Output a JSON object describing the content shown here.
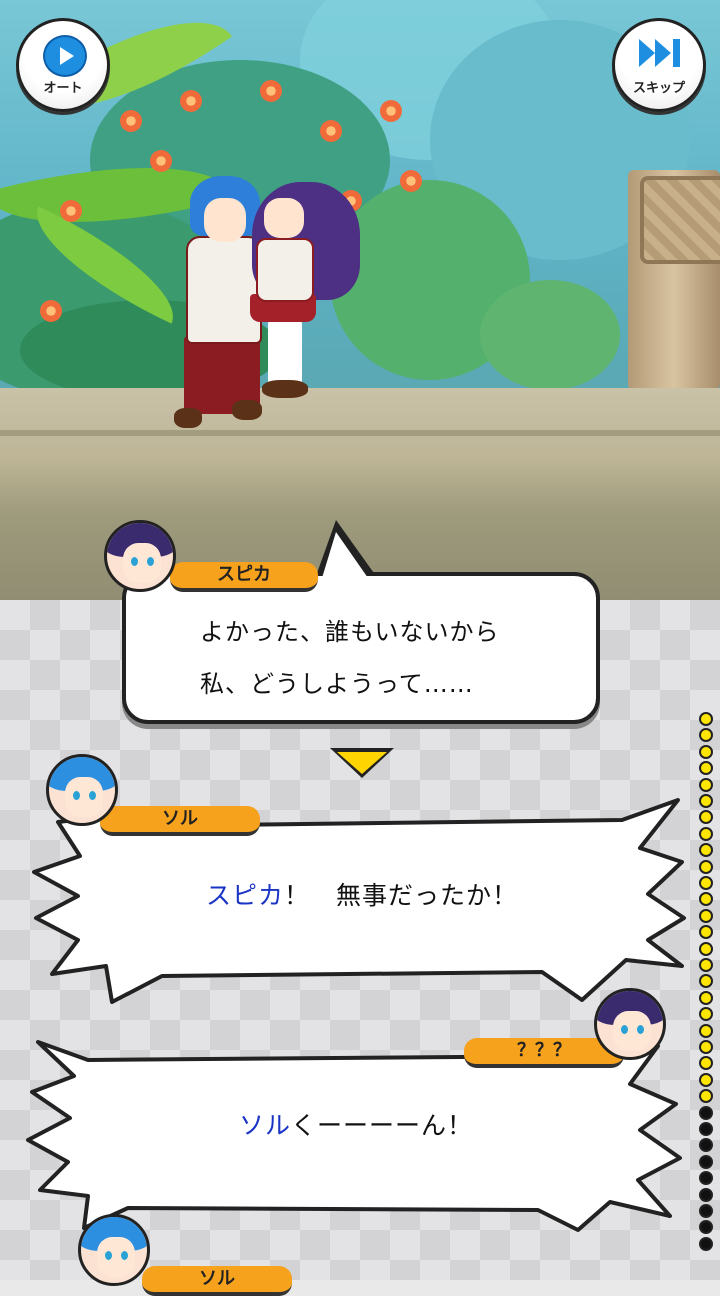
{
  "controls": {
    "auto_label": "オート",
    "skip_label": "スキップ"
  },
  "dialogue_log": [
    {
      "speaker": "スピカ",
      "lines": [
        "よかった、誰もいないから",
        "私、どうしようって……"
      ],
      "style": "round",
      "portrait": "spica"
    },
    {
      "speaker": "ソル",
      "highlight": "スピカ",
      "text": "！　無事だったか！",
      "style": "spiky",
      "portrait": "sol"
    },
    {
      "speaker": "？？？",
      "highlight": "ソル",
      "text": "くーーーーん！",
      "style": "spiky",
      "portrait": "spica"
    },
    {
      "speaker": "ソル",
      "style": "spiky",
      "portrait": "sol"
    }
  ],
  "colors": {
    "nameplate": "#f7a21c",
    "highlight": "#1a34c4",
    "next_arrow": "#ffd400"
  },
  "icons": [
    "play-icon",
    "skip-forward-icon",
    "next-arrow-icon"
  ]
}
